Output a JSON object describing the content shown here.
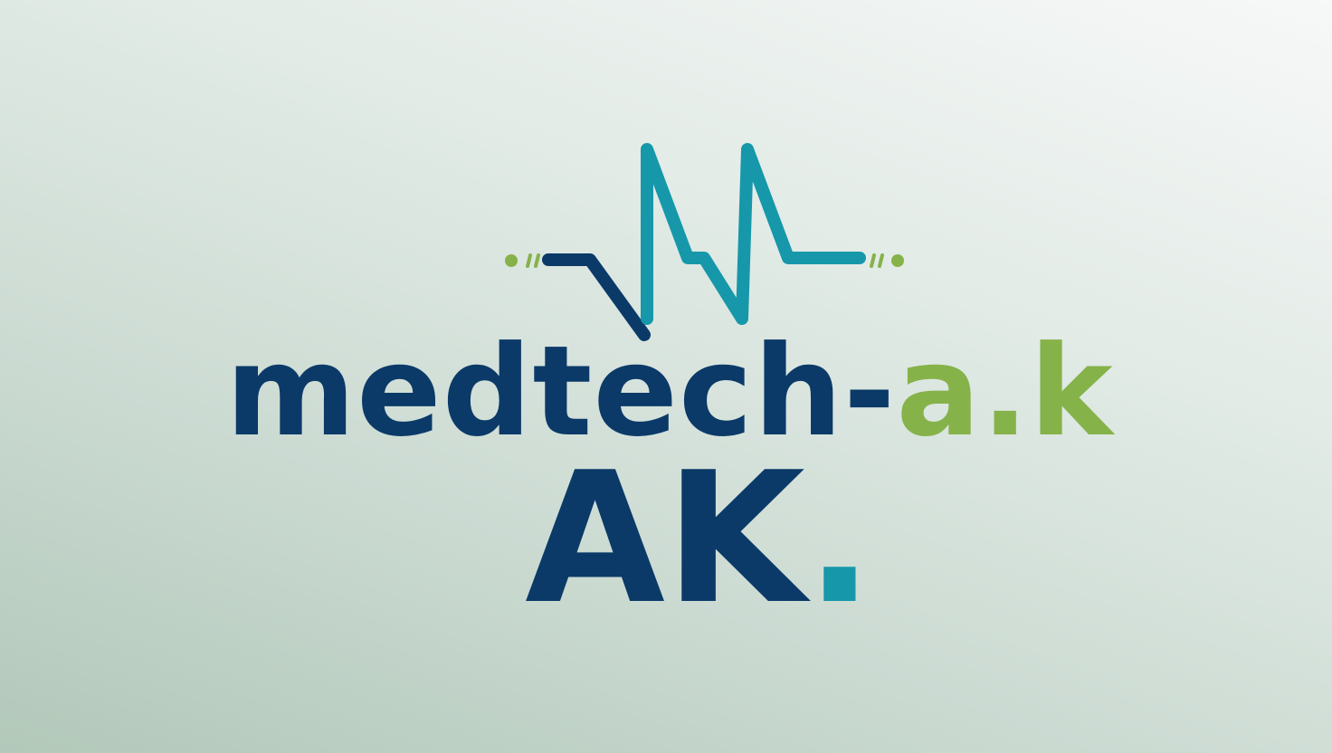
{
  "logo": {
    "wordmark_part1": "medtech-",
    "wordmark_part2": "a.k",
    "monogram": "AK",
    "monogram_dot": "."
  },
  "colors": {
    "navy": "#0b3a68",
    "teal": "#1698aa",
    "green": "#86b24a"
  },
  "icons": {
    "pulse": "heartbeat-pulse-icon"
  }
}
